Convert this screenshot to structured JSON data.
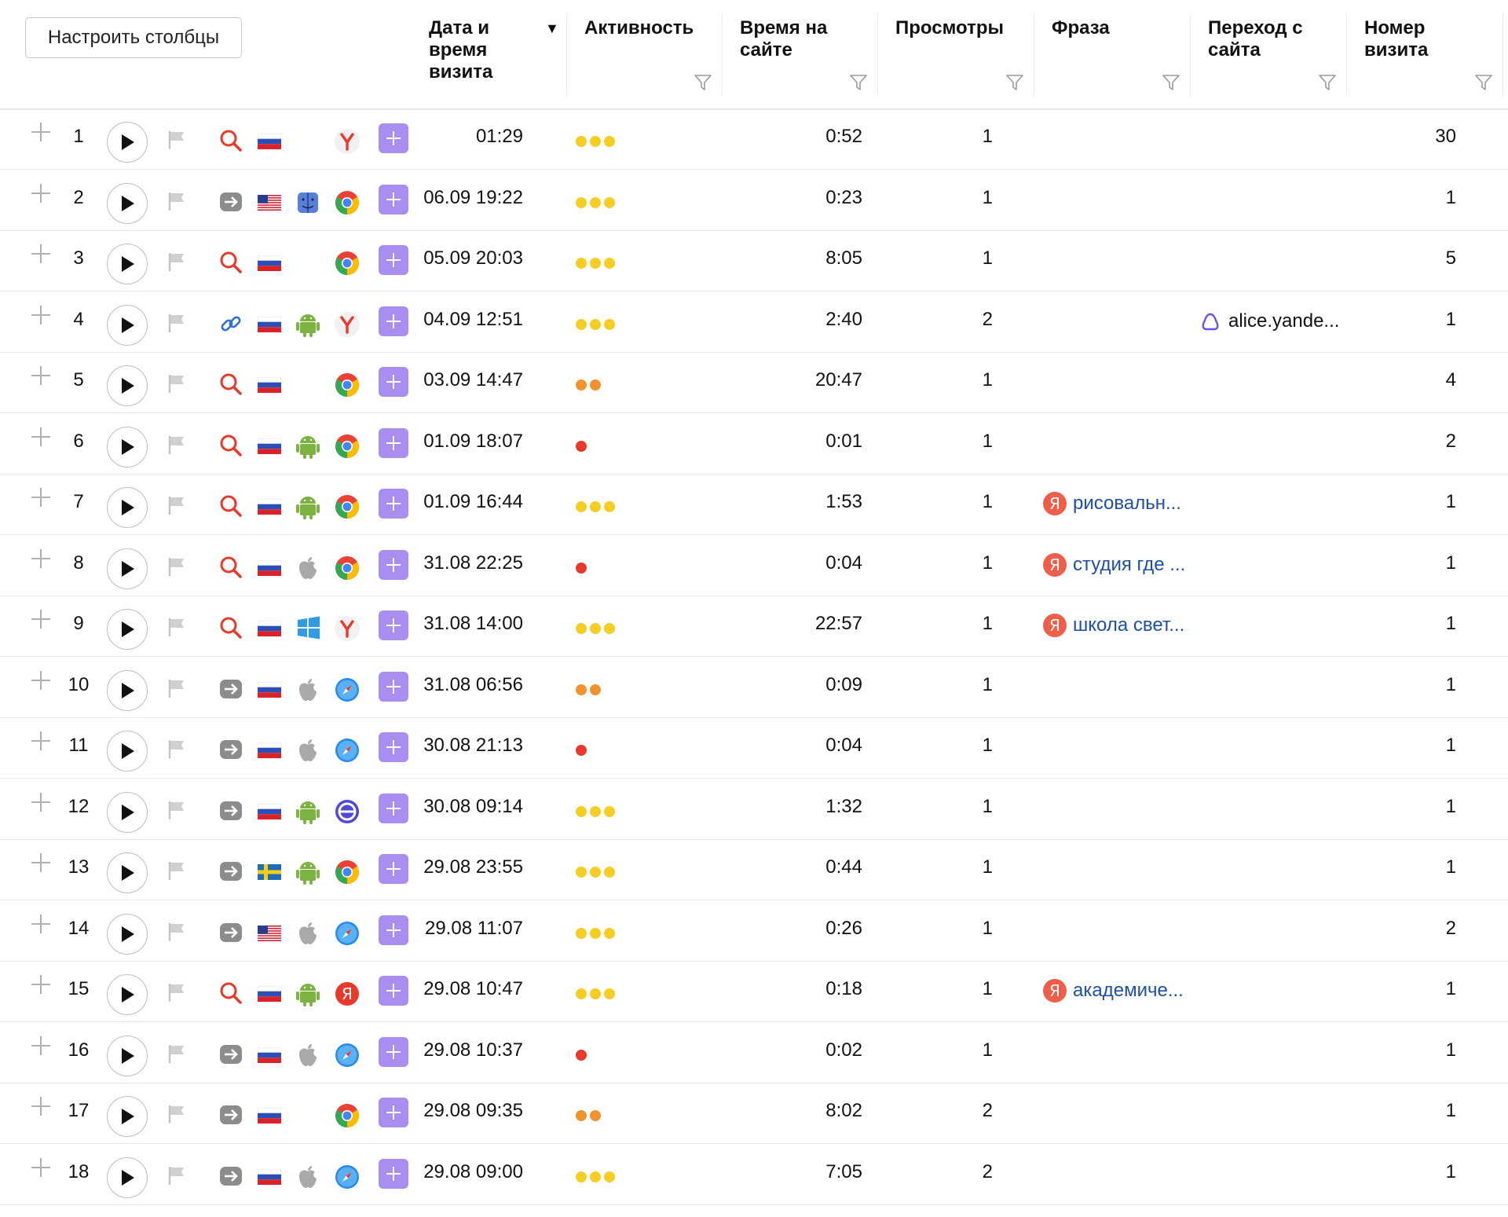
{
  "toolbar": {
    "configure_columns_label": "Настроить столбцы"
  },
  "columns": {
    "date": "Дата и время визита",
    "activity": "Активность",
    "time_on_site": "Время на сайте",
    "views": "Просмотры",
    "phrase": "Фраза",
    "referer": "Переход с сайта",
    "visit_number": "Номер визита"
  },
  "colors": {
    "activity_high": "#f5cd23",
    "activity_mid": "#f0932e",
    "activity_low": "#e8392b",
    "add_button": "#a98ef0",
    "phrase_link": "#1e4fa8",
    "yandex_red": "#ef5e48"
  },
  "rows": [
    {
      "n": "1",
      "source": "search",
      "country": "ru",
      "os": "",
      "browser": "yandex",
      "date": "01:29",
      "activity": 3,
      "time": "0:52",
      "views": "1",
      "phrase": "",
      "referer": "",
      "visit": "30"
    },
    {
      "n": "2",
      "source": "direct",
      "country": "us",
      "os": "mac",
      "browser": "chrome",
      "date": "06.09 19:22",
      "activity": 3,
      "time": "0:23",
      "views": "1",
      "phrase": "",
      "referer": "",
      "visit": "1"
    },
    {
      "n": "3",
      "source": "search",
      "country": "ru",
      "os": "",
      "browser": "chrome",
      "date": "05.09 20:03",
      "activity": 3,
      "time": "8:05",
      "views": "1",
      "phrase": "",
      "referer": "",
      "visit": "5"
    },
    {
      "n": "4",
      "source": "link",
      "country": "ru",
      "os": "android",
      "browser": "yandex",
      "date": "04.09 12:51",
      "activity": 3,
      "time": "2:40",
      "views": "2",
      "phrase": "",
      "referer": "alice.yande...",
      "visit": "1"
    },
    {
      "n": "5",
      "source": "search",
      "country": "ru",
      "os": "",
      "browser": "chrome",
      "date": "03.09 14:47",
      "activity": 2,
      "time": "20:47",
      "views": "1",
      "phrase": "",
      "referer": "",
      "visit": "4"
    },
    {
      "n": "6",
      "source": "search",
      "country": "ru",
      "os": "android",
      "browser": "chrome",
      "date": "01.09 18:07",
      "activity": 1,
      "time": "0:01",
      "views": "1",
      "phrase": "",
      "referer": "",
      "visit": "2"
    },
    {
      "n": "7",
      "source": "search",
      "country": "ru",
      "os": "android",
      "browser": "chrome",
      "date": "01.09 16:44",
      "activity": 3,
      "time": "1:53",
      "views": "1",
      "phrase": "рисовальн...",
      "referer": "",
      "visit": "1"
    },
    {
      "n": "8",
      "source": "search",
      "country": "ru",
      "os": "apple",
      "browser": "chrome",
      "date": "31.08 22:25",
      "activity": 1,
      "time": "0:04",
      "views": "1",
      "phrase": "студия где ...",
      "referer": "",
      "visit": "1"
    },
    {
      "n": "9",
      "source": "search",
      "country": "ru",
      "os": "windows",
      "browser": "yandex",
      "date": "31.08 14:00",
      "activity": 3,
      "time": "22:57",
      "views": "1",
      "phrase": "школа свет...",
      "referer": "",
      "visit": "1"
    },
    {
      "n": "10",
      "source": "direct",
      "country": "ru",
      "os": "apple",
      "browser": "safari",
      "date": "31.08 06:56",
      "activity": 2,
      "time": "0:09",
      "views": "1",
      "phrase": "",
      "referer": "",
      "visit": "1"
    },
    {
      "n": "11",
      "source": "direct",
      "country": "ru",
      "os": "apple",
      "browser": "safari",
      "date": "30.08 21:13",
      "activity": 1,
      "time": "0:04",
      "views": "1",
      "phrase": "",
      "referer": "",
      "visit": "1"
    },
    {
      "n": "12",
      "source": "direct",
      "country": "ru",
      "os": "android",
      "browser": "edge",
      "date": "30.08 09:14",
      "activity": 3,
      "time": "1:32",
      "views": "1",
      "phrase": "",
      "referer": "",
      "visit": "1"
    },
    {
      "n": "13",
      "source": "direct",
      "country": "se",
      "os": "android",
      "browser": "chrome",
      "date": "29.08 23:55",
      "activity": 3,
      "time": "0:44",
      "views": "1",
      "phrase": "",
      "referer": "",
      "visit": "1"
    },
    {
      "n": "14",
      "source": "direct",
      "country": "us",
      "os": "apple",
      "browser": "safari",
      "date": "29.08 11:07",
      "activity": 3,
      "time": "0:26",
      "views": "1",
      "phrase": "",
      "referer": "",
      "visit": "2"
    },
    {
      "n": "15",
      "source": "search",
      "country": "ru",
      "os": "android",
      "browser": "yabrowser",
      "date": "29.08 10:47",
      "activity": 3,
      "time": "0:18",
      "views": "1",
      "phrase": "академиче...",
      "referer": "",
      "visit": "1"
    },
    {
      "n": "16",
      "source": "direct",
      "country": "ru",
      "os": "apple",
      "browser": "safari",
      "date": "29.08 10:37",
      "activity": 1,
      "time": "0:02",
      "views": "1",
      "phrase": "",
      "referer": "",
      "visit": "1"
    },
    {
      "n": "17",
      "source": "direct",
      "country": "ru",
      "os": "",
      "browser": "chrome",
      "date": "29.08 09:35",
      "activity": 2,
      "time": "8:02",
      "views": "2",
      "phrase": "",
      "referer": "",
      "visit": "1"
    },
    {
      "n": "18",
      "source": "direct",
      "country": "ru",
      "os": "apple",
      "browser": "safari",
      "date": "29.08 09:00",
      "activity": 3,
      "time": "7:05",
      "views": "2",
      "phrase": "",
      "referer": "",
      "visit": "1"
    }
  ]
}
